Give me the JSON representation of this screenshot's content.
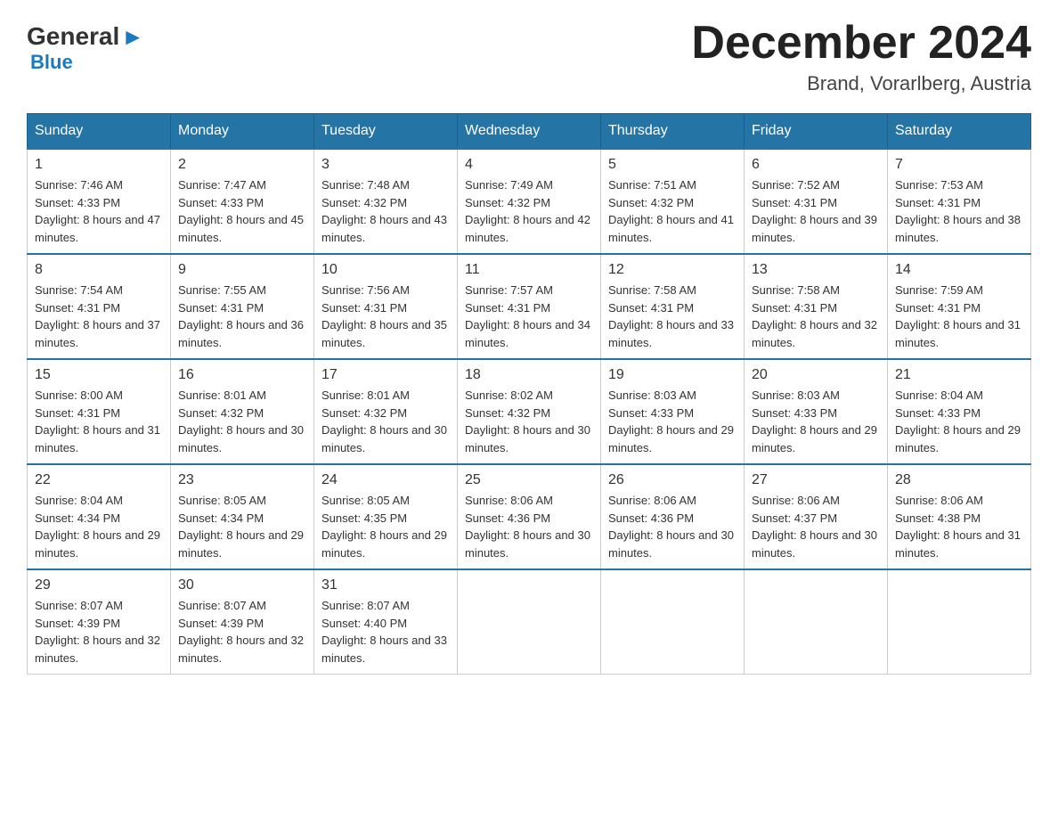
{
  "header": {
    "logo_general": "General",
    "logo_blue": "Blue",
    "month_title": "December 2024",
    "location": "Brand, Vorarlberg, Austria"
  },
  "weekdays": [
    "Sunday",
    "Monday",
    "Tuesday",
    "Wednesday",
    "Thursday",
    "Friday",
    "Saturday"
  ],
  "weeks": [
    [
      {
        "day": "1",
        "sunrise": "7:46 AM",
        "sunset": "4:33 PM",
        "daylight": "8 hours and 47 minutes."
      },
      {
        "day": "2",
        "sunrise": "7:47 AM",
        "sunset": "4:33 PM",
        "daylight": "8 hours and 45 minutes."
      },
      {
        "day": "3",
        "sunrise": "7:48 AM",
        "sunset": "4:32 PM",
        "daylight": "8 hours and 43 minutes."
      },
      {
        "day": "4",
        "sunrise": "7:49 AM",
        "sunset": "4:32 PM",
        "daylight": "8 hours and 42 minutes."
      },
      {
        "day": "5",
        "sunrise": "7:51 AM",
        "sunset": "4:32 PM",
        "daylight": "8 hours and 41 minutes."
      },
      {
        "day": "6",
        "sunrise": "7:52 AM",
        "sunset": "4:31 PM",
        "daylight": "8 hours and 39 minutes."
      },
      {
        "day": "7",
        "sunrise": "7:53 AM",
        "sunset": "4:31 PM",
        "daylight": "8 hours and 38 minutes."
      }
    ],
    [
      {
        "day": "8",
        "sunrise": "7:54 AM",
        "sunset": "4:31 PM",
        "daylight": "8 hours and 37 minutes."
      },
      {
        "day": "9",
        "sunrise": "7:55 AM",
        "sunset": "4:31 PM",
        "daylight": "8 hours and 36 minutes."
      },
      {
        "day": "10",
        "sunrise": "7:56 AM",
        "sunset": "4:31 PM",
        "daylight": "8 hours and 35 minutes."
      },
      {
        "day": "11",
        "sunrise": "7:57 AM",
        "sunset": "4:31 PM",
        "daylight": "8 hours and 34 minutes."
      },
      {
        "day": "12",
        "sunrise": "7:58 AM",
        "sunset": "4:31 PM",
        "daylight": "8 hours and 33 minutes."
      },
      {
        "day": "13",
        "sunrise": "7:58 AM",
        "sunset": "4:31 PM",
        "daylight": "8 hours and 32 minutes."
      },
      {
        "day": "14",
        "sunrise": "7:59 AM",
        "sunset": "4:31 PM",
        "daylight": "8 hours and 31 minutes."
      }
    ],
    [
      {
        "day": "15",
        "sunrise": "8:00 AM",
        "sunset": "4:31 PM",
        "daylight": "8 hours and 31 minutes."
      },
      {
        "day": "16",
        "sunrise": "8:01 AM",
        "sunset": "4:32 PM",
        "daylight": "8 hours and 30 minutes."
      },
      {
        "day": "17",
        "sunrise": "8:01 AM",
        "sunset": "4:32 PM",
        "daylight": "8 hours and 30 minutes."
      },
      {
        "day": "18",
        "sunrise": "8:02 AM",
        "sunset": "4:32 PM",
        "daylight": "8 hours and 30 minutes."
      },
      {
        "day": "19",
        "sunrise": "8:03 AM",
        "sunset": "4:33 PM",
        "daylight": "8 hours and 29 minutes."
      },
      {
        "day": "20",
        "sunrise": "8:03 AM",
        "sunset": "4:33 PM",
        "daylight": "8 hours and 29 minutes."
      },
      {
        "day": "21",
        "sunrise": "8:04 AM",
        "sunset": "4:33 PM",
        "daylight": "8 hours and 29 minutes."
      }
    ],
    [
      {
        "day": "22",
        "sunrise": "8:04 AM",
        "sunset": "4:34 PM",
        "daylight": "8 hours and 29 minutes."
      },
      {
        "day": "23",
        "sunrise": "8:05 AM",
        "sunset": "4:34 PM",
        "daylight": "8 hours and 29 minutes."
      },
      {
        "day": "24",
        "sunrise": "8:05 AM",
        "sunset": "4:35 PM",
        "daylight": "8 hours and 29 minutes."
      },
      {
        "day": "25",
        "sunrise": "8:06 AM",
        "sunset": "4:36 PM",
        "daylight": "8 hours and 30 minutes."
      },
      {
        "day": "26",
        "sunrise": "8:06 AM",
        "sunset": "4:36 PM",
        "daylight": "8 hours and 30 minutes."
      },
      {
        "day": "27",
        "sunrise": "8:06 AM",
        "sunset": "4:37 PM",
        "daylight": "8 hours and 30 minutes."
      },
      {
        "day": "28",
        "sunrise": "8:06 AM",
        "sunset": "4:38 PM",
        "daylight": "8 hours and 31 minutes."
      }
    ],
    [
      {
        "day": "29",
        "sunrise": "8:07 AM",
        "sunset": "4:39 PM",
        "daylight": "8 hours and 32 minutes."
      },
      {
        "day": "30",
        "sunrise": "8:07 AM",
        "sunset": "4:39 PM",
        "daylight": "8 hours and 32 minutes."
      },
      {
        "day": "31",
        "sunrise": "8:07 AM",
        "sunset": "4:40 PM",
        "daylight": "8 hours and 33 minutes."
      },
      null,
      null,
      null,
      null
    ]
  ]
}
